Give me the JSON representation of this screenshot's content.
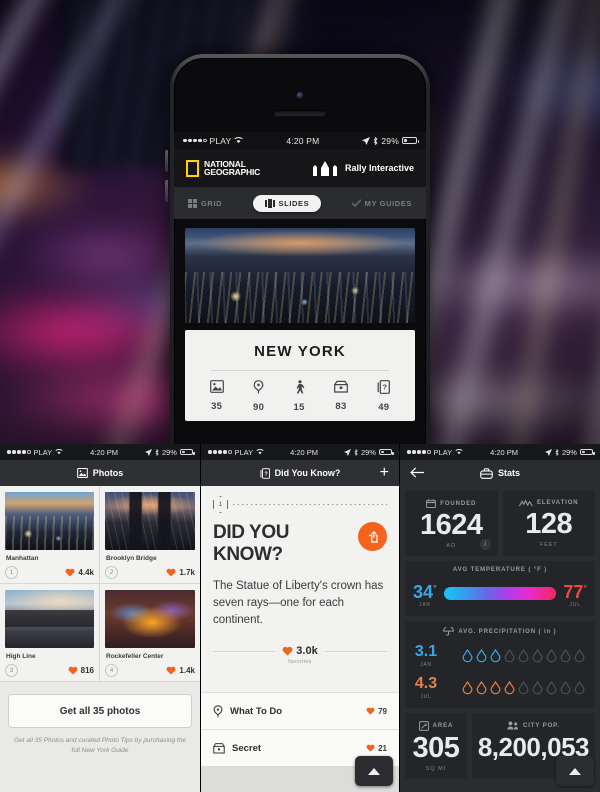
{
  "hero": {
    "status": {
      "carrier": "PLAY",
      "time": "4:20 PM",
      "battery": "29%"
    },
    "brand": {
      "line1": "NATIONAL",
      "line2": "GEOGRAPHIC",
      "partner": "Rally Interactive"
    },
    "segments": [
      {
        "label": "GRID",
        "icon": "grid-icon",
        "active": false
      },
      {
        "label": "SLIDES",
        "icon": "slides-icon",
        "active": true
      },
      {
        "label": "MY GUIDES",
        "icon": "check-icon",
        "active": false
      }
    ],
    "city": "NEW YORK",
    "city_stats": [
      {
        "icon": "photo-icon",
        "value": "35"
      },
      {
        "icon": "pin-icon",
        "value": "90"
      },
      {
        "icon": "walk-icon",
        "value": "15"
      },
      {
        "icon": "ticket-icon",
        "value": "83"
      },
      {
        "icon": "cards-icon",
        "value": "49"
      }
    ]
  },
  "photos_screen": {
    "status": {
      "carrier": "PLAY",
      "time": "4:20 PM",
      "battery": "29%"
    },
    "title": "Photos",
    "title_icon": "photo-icon",
    "items": [
      {
        "index": "1",
        "caption": "Manhattan",
        "likes": "4.4k"
      },
      {
        "index": "2",
        "caption": "Brooklyn Bridge",
        "likes": "1.7k"
      },
      {
        "index": "3",
        "caption": "High Line",
        "likes": "816"
      },
      {
        "index": "4",
        "caption": "Rockefeller Center",
        "likes": "1.4k"
      }
    ],
    "cta": "Get all 35 photos",
    "cta_sub": "Get all 35 Photos and curated Photo Tips by purchasing the full New York Guide"
  },
  "dyk_screen": {
    "status": {
      "carrier": "PLAY",
      "time": "4:20 PM",
      "battery": "29%"
    },
    "title": "Did You Know?",
    "title_icon": "cards-icon",
    "add_label": "+",
    "card_number": "1",
    "heading": "DID YOU KNOW?",
    "share_icon": "share-icon",
    "body": "The Statue of Liberty's crown has seven rays—one for each continent.",
    "favorites_value": "3.0k",
    "favorites_label": "favorites",
    "rows": [
      {
        "icon": "pin-icon",
        "label": "What To Do",
        "count": "79"
      },
      {
        "icon": "lock-icon",
        "label": "Secret",
        "count": "21"
      }
    ]
  },
  "stats_screen": {
    "status": {
      "carrier": "PLAY",
      "time": "4:20 PM",
      "battery": "29%"
    },
    "title": "Stats",
    "title_icon": "briefcase-icon",
    "back_icon": "arrow-left-icon",
    "boxes": [
      {
        "label": "FOUNDED",
        "icon": "calendar-icon",
        "value": "1624",
        "unit": "AD",
        "info": "i"
      },
      {
        "label": "ELEVATION",
        "icon": "mountain-icon",
        "value": "128",
        "unit": "FEET"
      },
      {
        "label": "AREA",
        "icon": "area-icon",
        "value": "305",
        "unit": "SQ MI"
      },
      {
        "label": "CITY POP.",
        "icon": "people-icon",
        "value": "8,200,053",
        "unit": ""
      }
    ],
    "temperature": {
      "label": "AVG TEMPERATURE ( °F )",
      "icon": "thermometer-icon",
      "low": {
        "value": "34",
        "month": "JAN",
        "color": "#3aa7e8"
      },
      "high": {
        "value": "77",
        "month": "JUL",
        "color": "#f04a3a"
      }
    },
    "precipitation": {
      "label": "AVG. PRECIPITATION ( in )",
      "icon": "umbrella-icon",
      "total_drops": 9,
      "rows": [
        {
          "value": "3.1",
          "month": "JAN",
          "filled": 3,
          "color": "#3aa7e8"
        },
        {
          "value": "4.3",
          "month": "JUL",
          "filled": 4,
          "color": "#e8804a"
        }
      ]
    }
  },
  "colors": {
    "accent": "#f4631e",
    "heart": "#f4631e",
    "natgeo_yellow": "#ffd200"
  }
}
